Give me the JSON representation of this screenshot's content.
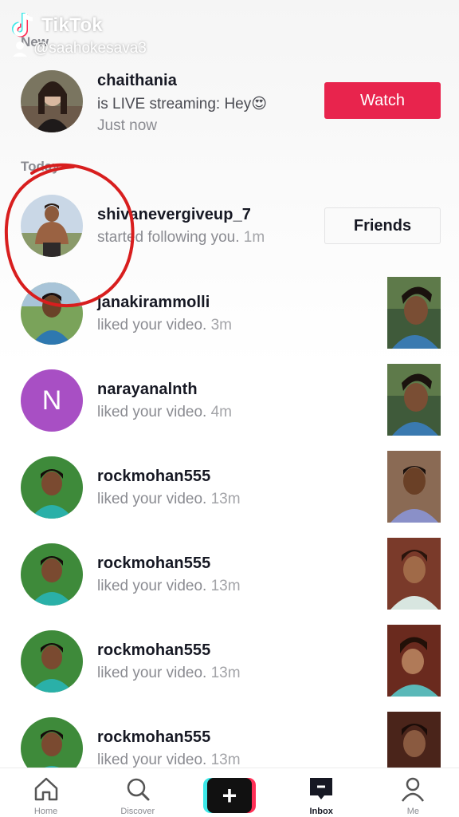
{
  "watermark": {
    "brand": "TikTok",
    "handle": "@saahokesava3"
  },
  "sections": {
    "new": "New",
    "today": "Today"
  },
  "live": {
    "username": "chaithania",
    "message": "is LIVE streaming: Hey😍",
    "time": "Just now",
    "action": "Watch"
  },
  "follow": {
    "username": "shivanevergiveup_7",
    "message": "started following you.",
    "time": "1m",
    "action": "Friends"
  },
  "likes": [
    {
      "username": "janakirammolli",
      "message": "liked your video.",
      "time": "3m",
      "avatar_letter": ""
    },
    {
      "username": "narayanalnth",
      "message": "liked your video.",
      "time": "4m",
      "avatar_letter": "N"
    },
    {
      "username": "rockmohan555",
      "message": "liked your video.",
      "time": "13m",
      "avatar_letter": ""
    },
    {
      "username": "rockmohan555",
      "message": "liked your video.",
      "time": "13m",
      "avatar_letter": ""
    },
    {
      "username": "rockmohan555",
      "message": "liked your video.",
      "time": "13m",
      "avatar_letter": ""
    },
    {
      "username": "rockmohan555",
      "message": "liked your video.",
      "time": "13m",
      "avatar_letter": ""
    }
  ],
  "nav": {
    "home": "Home",
    "discover": "Discover",
    "create": "+",
    "inbox": "Inbox",
    "me": "Me"
  },
  "colors": {
    "accent": "#e8244d",
    "annotation": "#d81e1e",
    "letter_avatar": "#a84fc4"
  }
}
